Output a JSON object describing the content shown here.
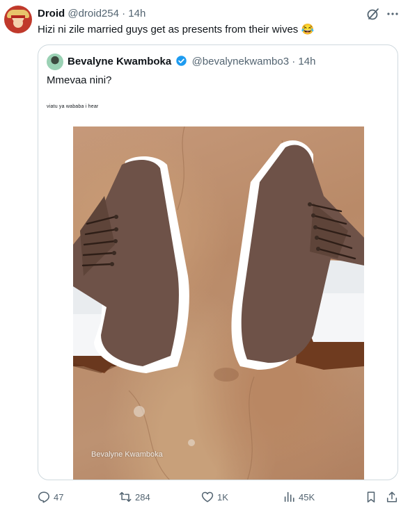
{
  "author": {
    "name": "Droid",
    "handle": "@droid254",
    "separator": "·",
    "time": "14h"
  },
  "tweet_text": "Hizi ni zile married guys get as presents from their wives 😂",
  "quoted": {
    "name": "Bevalyne Kwamboka",
    "handle": "@bevalynekwambo3",
    "separator": "·",
    "time": "14h",
    "text": "Mmevaa nini?",
    "caption": "viatu ya wababa i hear",
    "image_watermark": "Bevalyne Kwamboka",
    "verified_color": "#1d9bf0"
  },
  "metrics": {
    "replies": "47",
    "retweets": "284",
    "likes": "1K",
    "views": "45K"
  },
  "icons": {
    "grok": "grok-icon",
    "more": "more-icon",
    "reply": "reply-icon",
    "retweet": "retweet-icon",
    "like": "like-icon",
    "views": "views-icon",
    "bookmark": "bookmark-icon",
    "share": "share-icon"
  },
  "colors": {
    "text": "#0f1419",
    "secondary": "#536471",
    "border": "#cfd9de"
  }
}
